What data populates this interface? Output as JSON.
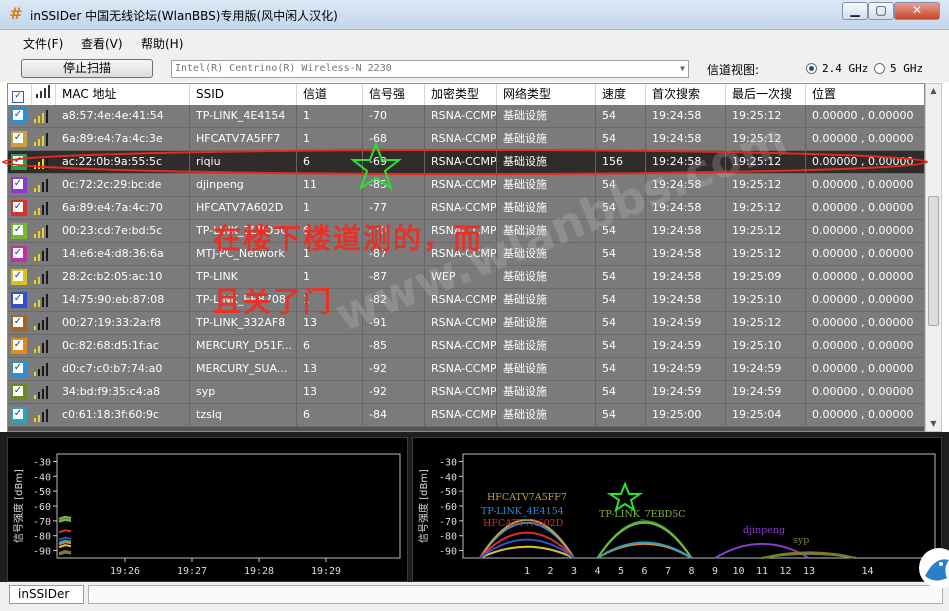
{
  "window": {
    "title": "inSSIDer 中国无线论坛(WlanBBS)专用版(风中闲人汉化)",
    "min_glyph": "▁",
    "max_glyph": "▢",
    "close_glyph": "✕"
  },
  "menu": [
    "文件(F)",
    "查看(V)",
    "帮助(H)"
  ],
  "toolbar": {
    "stop_label": "停止扫描",
    "adapter": "Intel(R) Centrino(R) Wireless-N 2230",
    "channel_view_label": "信道视图:",
    "band_24": "2.4 GHz",
    "band_5": "5 GHz",
    "selected_band": "2.4 GHz"
  },
  "table": {
    "columns": [
      "MAC 地址",
      "SSID",
      "信道",
      "信号强",
      "加密类型",
      "网络类型",
      "速度",
      "首次搜索",
      "最后一次搜",
      "位置"
    ],
    "rows": [
      {
        "color": "#2a8fd6",
        "mac": "a8:57:4e:4e:41:54",
        "ssid": "TP-LINK_4E4154",
        "channel": "1",
        "rssi": "-70",
        "security": "RSNA-CCMP",
        "type": "基础设施",
        "speed": "54",
        "first": "19:24:58",
        "last": "19:25:12",
        "location": "0.00000 , 0.00000",
        "bars": 3
      },
      {
        "color": "#c9a13a",
        "mac": "6a:89:e4:7a:4c:3e",
        "ssid": "HFCATV7A5FF7",
        "channel": "1",
        "rssi": "-68",
        "security": "RSNA-CCMP",
        "type": "基础设施",
        "speed": "54",
        "first": "19:24:58",
        "last": "19:25:12",
        "location": "0.00000 , 0.00000",
        "bars": 3
      },
      {
        "color": "#2f9e4a",
        "mac": "ac:22:0b:9a:55:5c",
        "ssid": "riqiu",
        "channel": "6",
        "rssi": "-69",
        "security": "RSNA-CCMP",
        "type": "基础设施",
        "speed": "156",
        "first": "19:24:58",
        "last": "19:25:12",
        "location": "0.00000 , 0.00000",
        "bars": 3,
        "selected": true
      },
      {
        "color": "#8a3ad0",
        "mac": "0c:72:2c:29:bc:de",
        "ssid": "djinpeng",
        "channel": "11",
        "rssi": "-85",
        "security": "RSNA-CCMP",
        "type": "基础设施",
        "speed": "54",
        "first": "19:24:58",
        "last": "19:25:12",
        "location": "0.00000 , 0.00000",
        "bars": 2
      },
      {
        "color": "#d83030",
        "mac": "6a:89:e4:7a:4c:70",
        "ssid": "HFCATV7A602D",
        "channel": "1",
        "rssi": "-77",
        "security": "RSNA-CCMP",
        "type": "基础设施",
        "speed": "54",
        "first": "19:24:58",
        "last": "19:25:12",
        "location": "0.00000 , 0.00000",
        "bars": 2
      },
      {
        "color": "#7ab830",
        "mac": "00:23:cd:7e:bd:5c",
        "ssid": "TP-LINK_7EBD5C",
        "channel": "6",
        "rssi": "-70",
        "security": "RSNA-CCMP",
        "type": "基础设施",
        "speed": "54",
        "first": "19:24:58",
        "last": "19:25:12",
        "location": "0.00000 , 0.00000",
        "bars": 3
      },
      {
        "color": "#c030a0",
        "mac": "14:e6:e4:d8:36:6a",
        "ssid": "MTJ-PC_Network",
        "channel": "1",
        "rssi": "-87",
        "security": "RSNA-CCMP",
        "type": "基础设施",
        "speed": "54",
        "first": "19:24:58",
        "last": "19:25:12",
        "location": "0.00000 , 0.00000",
        "bars": 2
      },
      {
        "color": "#d8c020",
        "mac": "28:2c:b2:05:ac:10",
        "ssid": "TP-LINK",
        "channel": "1",
        "rssi": "-87",
        "security": "WEP",
        "type": "基础设施",
        "speed": "54",
        "first": "19:24:58",
        "last": "19:25:09",
        "location": "0.00000 , 0.00000",
        "bars": 2
      },
      {
        "color": "#3050c8",
        "mac": "14:75:90:eb:87:08",
        "ssid": "TP-LINK_EB8708",
        "channel": "1",
        "rssi": "-82",
        "security": "RSNA-CCMP",
        "type": "基础设施",
        "speed": "54",
        "first": "19:24:58",
        "last": "19:25:10",
        "location": "0.00000 , 0.00000",
        "bars": 2
      },
      {
        "color": "#a06828",
        "mac": "00:27:19:33:2a:f8",
        "ssid": "TP-LINK_332AF8",
        "channel": "13",
        "rssi": "-91",
        "security": "RSNA-CCMP",
        "type": "基础设施",
        "speed": "54",
        "first": "19:24:59",
        "last": "19:25:12",
        "location": "0.00000 , 0.00000",
        "bars": 1
      },
      {
        "color": "#e08a20",
        "mac": "0c:82:68:d5:1f:ac",
        "ssid": "MERCURY_D51F...",
        "channel": "6",
        "rssi": "-85",
        "security": "RSNA-CCMP",
        "type": "基础设施",
        "speed": "54",
        "first": "19:24:59",
        "last": "19:25:10",
        "location": "0.00000 , 0.00000",
        "bars": 2
      },
      {
        "color": "#2a8fd6",
        "mac": "d0:c7:c0:b7:74:a0",
        "ssid": "MERCURY_SUA...",
        "channel": "13",
        "rssi": "-92",
        "security": "RSNA-CCMP",
        "type": "基础设施",
        "speed": "54",
        "first": "19:24:59",
        "last": "19:24:59",
        "location": "0.00000 , 0.00000",
        "bars": 1
      },
      {
        "color": "#6a8a20",
        "mac": "34:bd:f9:35:c4:a8",
        "ssid": "syp",
        "channel": "13",
        "rssi": "-92",
        "security": "RSNA-CCMP",
        "type": "基础设施",
        "speed": "54",
        "first": "19:24:59",
        "last": "19:24:59",
        "location": "0.00000 , 0.00000",
        "bars": 1
      },
      {
        "color": "#30a0c0",
        "mac": "c0:61:18:3f:60:9c",
        "ssid": "tzslq",
        "channel": "6",
        "rssi": "-84",
        "security": "RSNA-CCMP",
        "type": "基础设施",
        "speed": "54",
        "first": "19:25:00",
        "last": "19:25:04",
        "location": "0.00000 , 0.00000",
        "bars": 2
      }
    ]
  },
  "overlay": {
    "line1": "在楼下楼道测的，而",
    "line2": "且关了门",
    "watermark": "www.wlanbbs.com"
  },
  "time_graph": {
    "y_title": "信号强度 [dBm]",
    "y_ticks": [
      "-30",
      "-40",
      "-50",
      "-60",
      "-70",
      "-80",
      "-90"
    ],
    "x_ticks": [
      "19:26",
      "19:27",
      "19:28",
      "19:29"
    ]
  },
  "channel_graph": {
    "y_title": "信号强度 [dBm]",
    "y_ticks": [
      "-30",
      "-40",
      "-50",
      "-60",
      "-70",
      "-80",
      "-90"
    ],
    "x_ticks": [
      "1",
      "2",
      "3",
      "4",
      "5",
      "6",
      "7",
      "8",
      "9",
      "10",
      "11",
      "12",
      "13",
      "14"
    ],
    "labels": [
      {
        "text": "HFCATV7A5FF7",
        "color": "#c9a13a"
      },
      {
        "text": "TP-LINK_4E4154",
        "color": "#2a8fd6"
      },
      {
        "text": "HFCATV7A602D",
        "color": "#d83030"
      },
      {
        "text": "TP-LINK_7EBD5C",
        "color": "#7ab830"
      },
      {
        "text": "djinpeng",
        "color": "#8a3ad0"
      },
      {
        "text": "syp",
        "color": "#6a8a20"
      }
    ]
  },
  "status": {
    "tab": "inSSIDer"
  }
}
